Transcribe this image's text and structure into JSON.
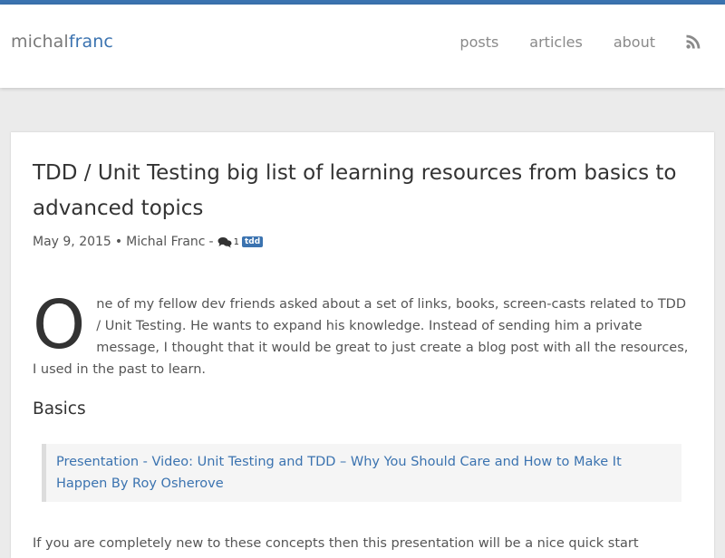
{
  "colors": {
    "accent": "#3b73b0",
    "header_bg": "#ffffff",
    "page_bg": "#ebebeb",
    "text": "#333333",
    "muted_text": "#555555"
  },
  "header": {
    "logo_part1": "michal",
    "logo_part2": "franc",
    "nav": {
      "posts": "posts",
      "articles": "articles",
      "about": "about",
      "rss_icon": "rss-icon"
    }
  },
  "post": {
    "title": "TDD / Unit Testing big list of learning resources from basics to advanced topics",
    "meta": {
      "date": "May 9, 2015",
      "separator": "•",
      "author": "Michal Franc",
      "dash": "-",
      "comment_icon": "comment-icon",
      "comment_count": "1",
      "tag": "tdd"
    },
    "intro_dropcap": "O",
    "intro_rest": "ne of my fellow dev friends asked about a set of links, books, screen-casts related to TDD / Unit Testing. He wants to expand his knowledge. Instead of sending him a private message, I thought that it would be great to just create a blog post with all the resources, I used in the past to learn.",
    "section_heading": "Basics",
    "quote_link": "Presentation - Video: Unit Testing and TDD – Why You Should Care and How to Make It Happen By Roy Osherove",
    "next_paragraph": "If you are completely new to these concepts then this presentation will be a nice quick start"
  }
}
